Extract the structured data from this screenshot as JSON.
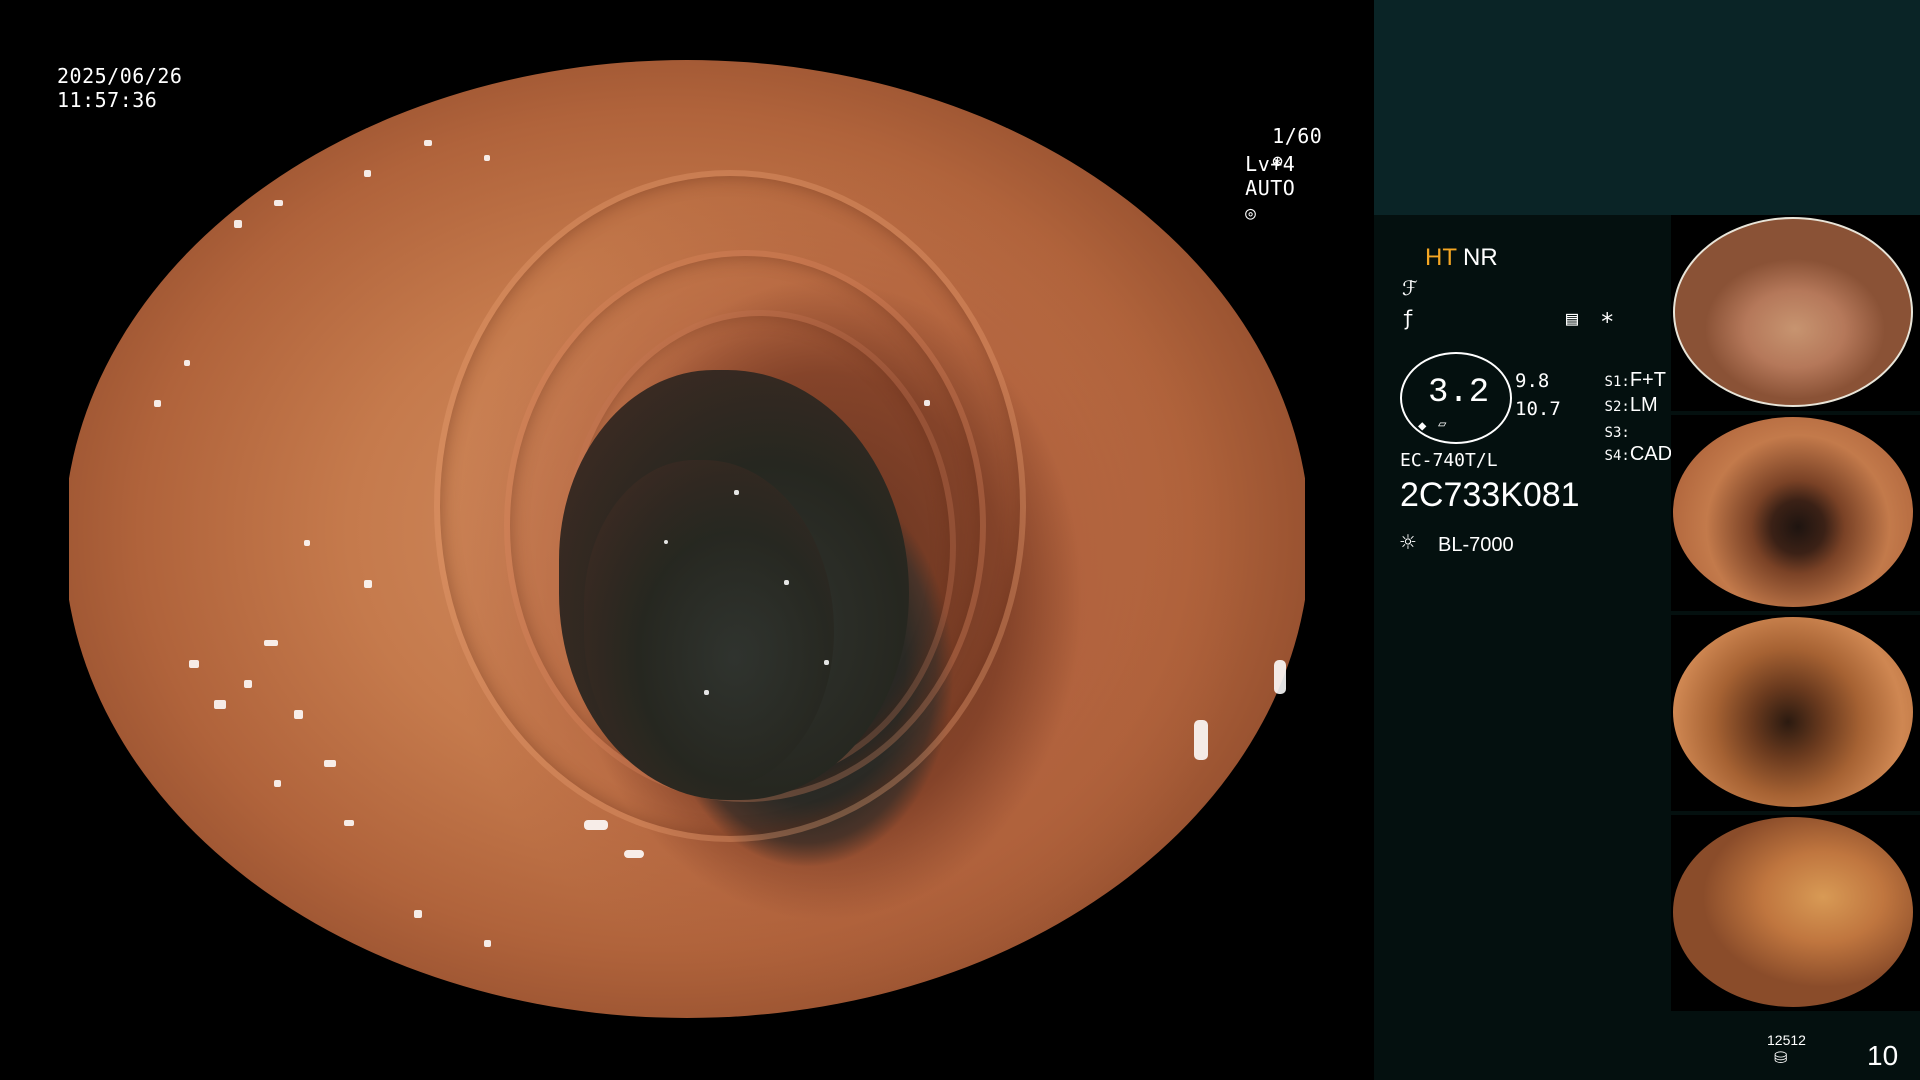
{
  "overlay": {
    "date": "2025/06/26",
    "time": "11:57:36",
    "shutter": "1/60",
    "level": "Lv+4",
    "mode": "AUTO"
  },
  "panel": {
    "ht_label": "HT",
    "nr_label": "NR",
    "zoom_value": "3.2",
    "value_top": "9.8",
    "value_bottom": "10.7",
    "switches": [
      {
        "label": "S1:",
        "value": "F+T"
      },
      {
        "label": "S2:",
        "value": "LM"
      },
      {
        "label": "S3:",
        "value": ""
      },
      {
        "label": "S4:",
        "value": "CAD"
      }
    ],
    "asterisk": "*",
    "scope_model": "EC-740T/L",
    "serial": "2C733K081",
    "light_source": "BL-7000",
    "counter": "12512",
    "capture_count": "10"
  },
  "colors": {
    "ht_accent": "#f5a623",
    "panel_top_bg": "#0a2426",
    "panel_body_bg": "#04100f"
  }
}
